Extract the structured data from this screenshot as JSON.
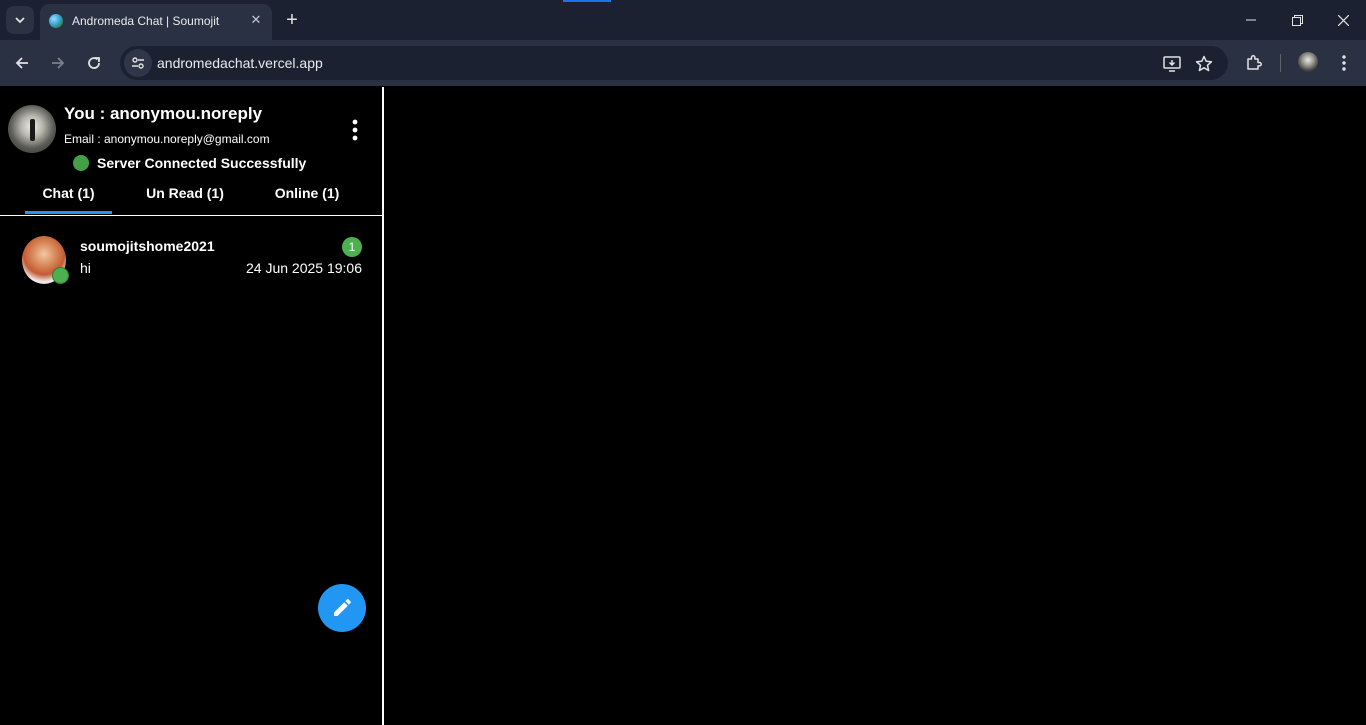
{
  "browser": {
    "tab_title": "Andromeda Chat | Soumojit",
    "url": "andromedachat.vercel.app"
  },
  "user": {
    "title": "You : anonymou.noreply",
    "email": "Email : anonymou.noreply@gmail.com"
  },
  "status": {
    "text": "Server Connected Successfully",
    "color": "#43a047"
  },
  "tabs": [
    {
      "label": "Chat (1)",
      "active": true
    },
    {
      "label": "Un Read (1)",
      "active": false
    },
    {
      "label": "Online (1)",
      "active": false
    }
  ],
  "chats": [
    {
      "name": "soumojitshome2021",
      "last_message": "hi",
      "time": "24 Jun 2025 19:06",
      "unread": "1",
      "online": true
    }
  ],
  "colors": {
    "accent": "#2196f3",
    "online": "#4caf50"
  },
  "icons": {
    "fab": "pencil-icon",
    "menu": "more-vert-icon"
  }
}
